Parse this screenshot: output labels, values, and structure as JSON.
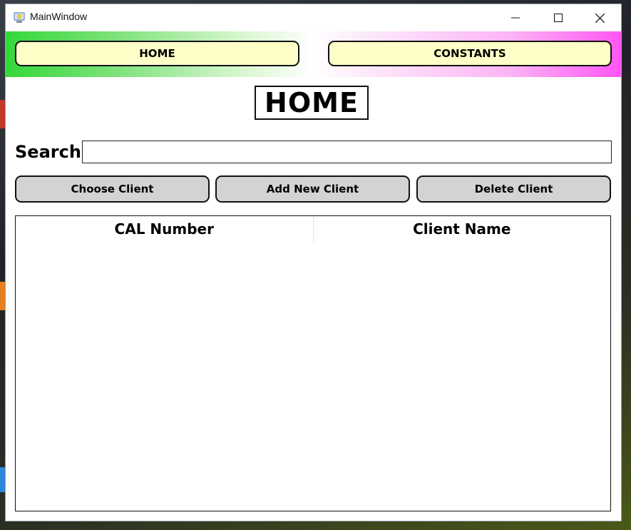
{
  "window": {
    "title": "MainWindow",
    "controls": {
      "minimize": "minimize-icon",
      "maximize": "maximize-icon",
      "close": "close-icon"
    }
  },
  "nav": {
    "home_label": "HOME",
    "constants_label": "CONSTANTS"
  },
  "page": {
    "title": "HOME"
  },
  "search": {
    "label": "Search",
    "value": ""
  },
  "actions": {
    "choose_label": "Choose Client",
    "add_label": "Add New Client",
    "delete_label": "Delete Client"
  },
  "table": {
    "columns": [
      "CAL Number",
      "Client Name"
    ],
    "rows": []
  },
  "colors": {
    "nav_button_bg": "#fefec8",
    "action_button_bg": "#d3d3d3",
    "nav_gradient_left": "#33d83a",
    "nav_gradient_right": "#ff55f3"
  }
}
